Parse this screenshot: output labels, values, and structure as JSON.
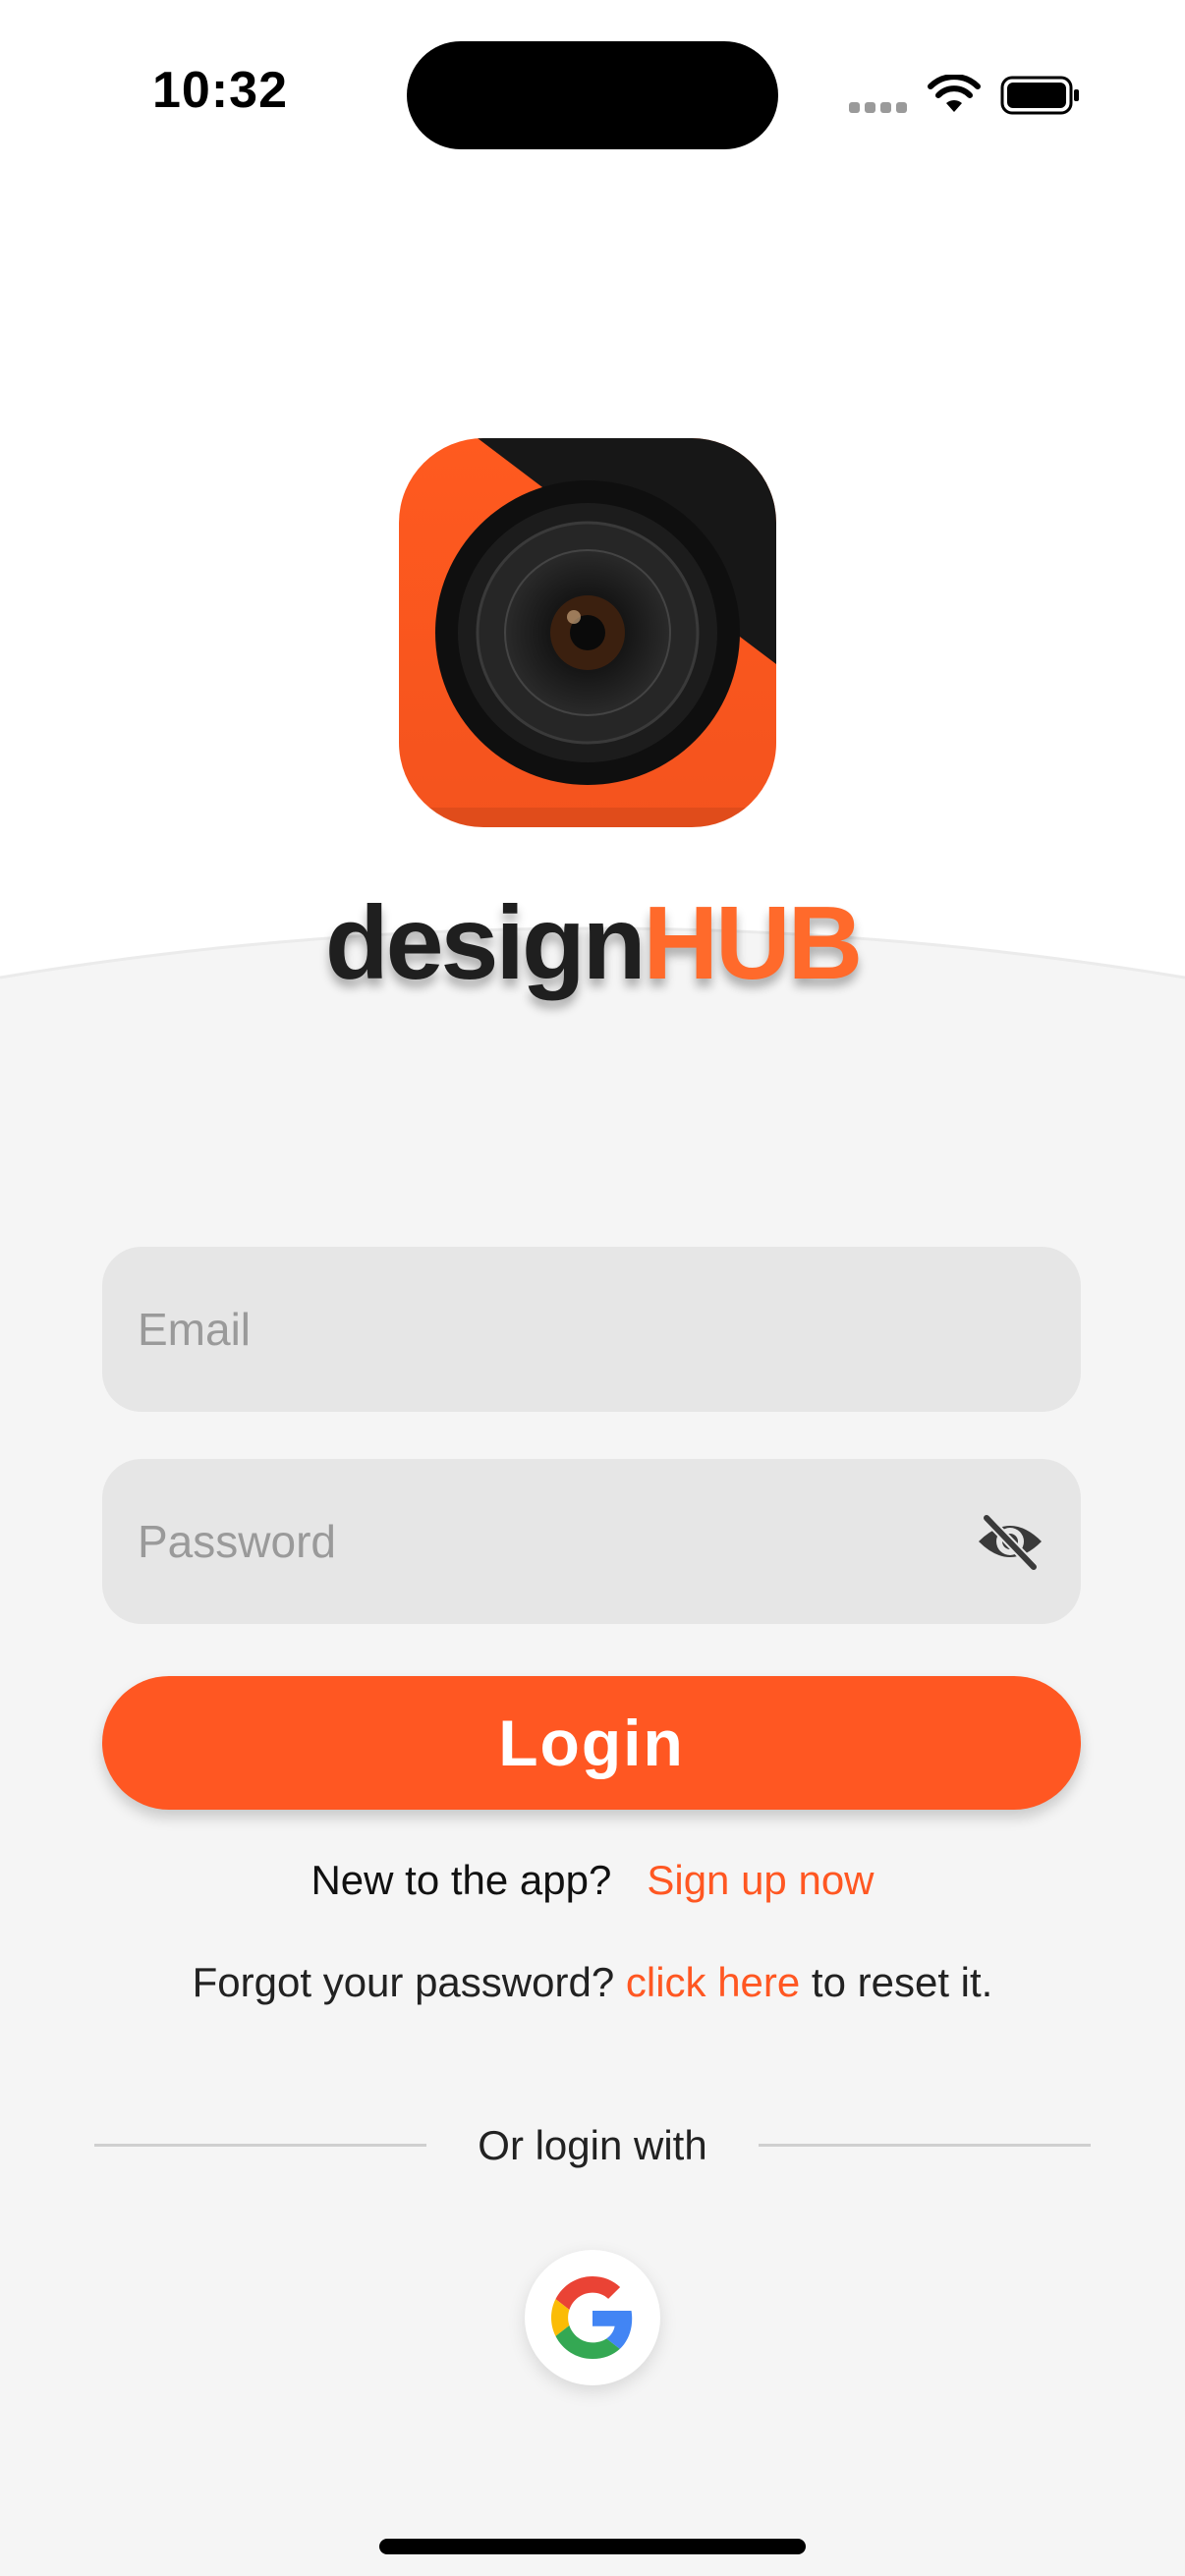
{
  "status_bar": {
    "time": "10:32",
    "icons": [
      "signal-icon",
      "wifi-icon",
      "battery-icon"
    ]
  },
  "brand": {
    "logo_icon": "camera-lens-icon",
    "name_part1": "design",
    "name_part2": "HUB",
    "colors": {
      "accent": "#ff5722",
      "dark": "#1f1f1f",
      "hub": "#ff6a2b"
    }
  },
  "form": {
    "email": {
      "value": "",
      "placeholder": "Email"
    },
    "password": {
      "value": "",
      "placeholder": "Password",
      "toggle_icon": "eye-off-icon"
    },
    "login_label": "Login"
  },
  "signup": {
    "prompt": "New to the app?",
    "link": "Sign up now"
  },
  "forgot": {
    "prefix": "Forgot your password? ",
    "link": "click here",
    "suffix": " to reset it."
  },
  "social": {
    "divider_text": "Or login with",
    "providers": [
      "google-icon"
    ]
  },
  "colors": {
    "background_top": "#ffffff",
    "background": "#f5f5f5",
    "input_bg": "#e6e6e6",
    "primary": "#ff5722"
  }
}
